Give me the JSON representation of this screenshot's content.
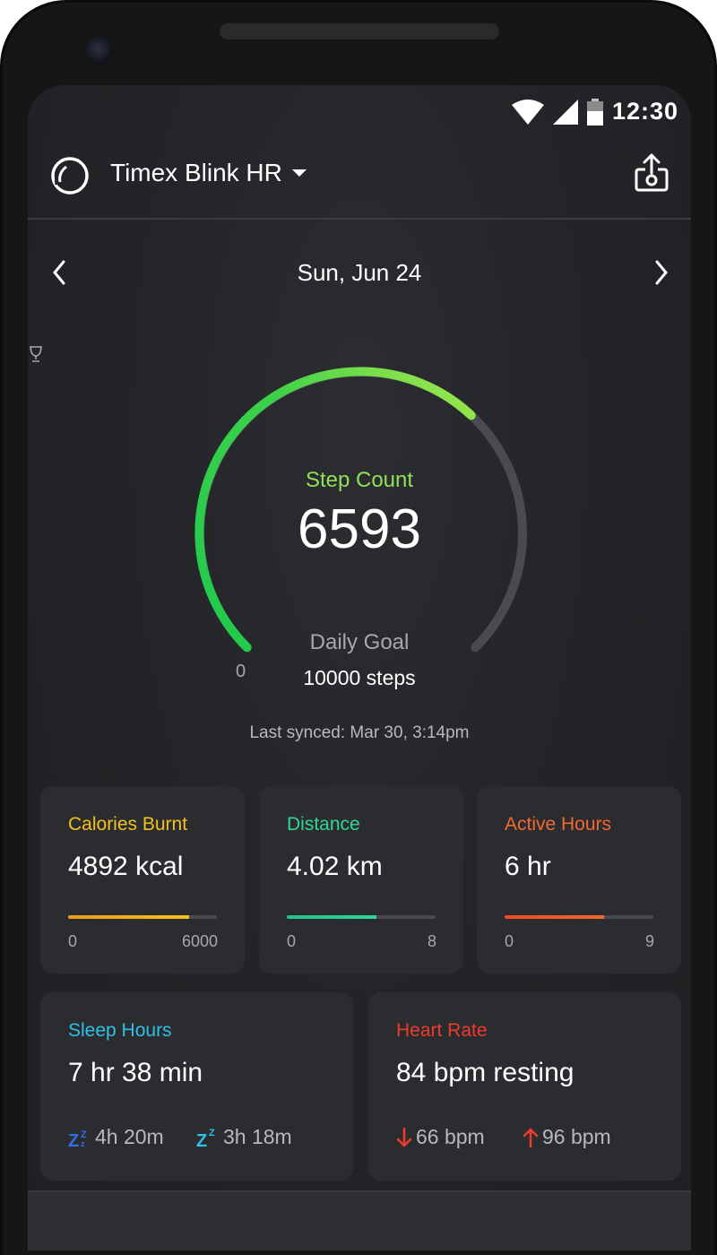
{
  "status_bar": {
    "time": "12:30"
  },
  "app_bar": {
    "device_name": "Timex Blink HR"
  },
  "date_nav": {
    "date": "Sun, Jun 24"
  },
  "step_gauge": {
    "label": "Step Count",
    "value": "6593",
    "min_label": "0",
    "goal_label": "Daily Goal",
    "goal_value": "10000 steps",
    "progress": 0.6593
  },
  "last_synced": "Last synced: Mar 30, 3:14pm",
  "cards": {
    "calories": {
      "title": "Calories Burnt",
      "value": "4892 kcal",
      "min": "0",
      "max": "6000",
      "progress": 0.815,
      "color": "#f2c21b",
      "fill_start": "#f09a1e"
    },
    "distance": {
      "title": "Distance",
      "value": "4.02 km",
      "min": "0",
      "max": "8",
      "progress": 0.6,
      "color": "#2fd59a",
      "fill_start": "#27c08a"
    },
    "active": {
      "title": "Active Hours",
      "value": "6 hr",
      "min": "0",
      "max": "9",
      "progress": 0.667,
      "color": "#f2692f",
      "fill_start": "#ef4a25"
    },
    "sleep": {
      "title": "Sleep Hours",
      "value": "7 hr  38 min",
      "deep": "4h 20m",
      "light": "3h 18m",
      "color": "#2fc0e8"
    },
    "heart": {
      "title": "Heart Rate",
      "value": "84 bpm resting",
      "low": "66 bpm",
      "high": "96 bpm",
      "color": "#f03a2a"
    }
  }
}
